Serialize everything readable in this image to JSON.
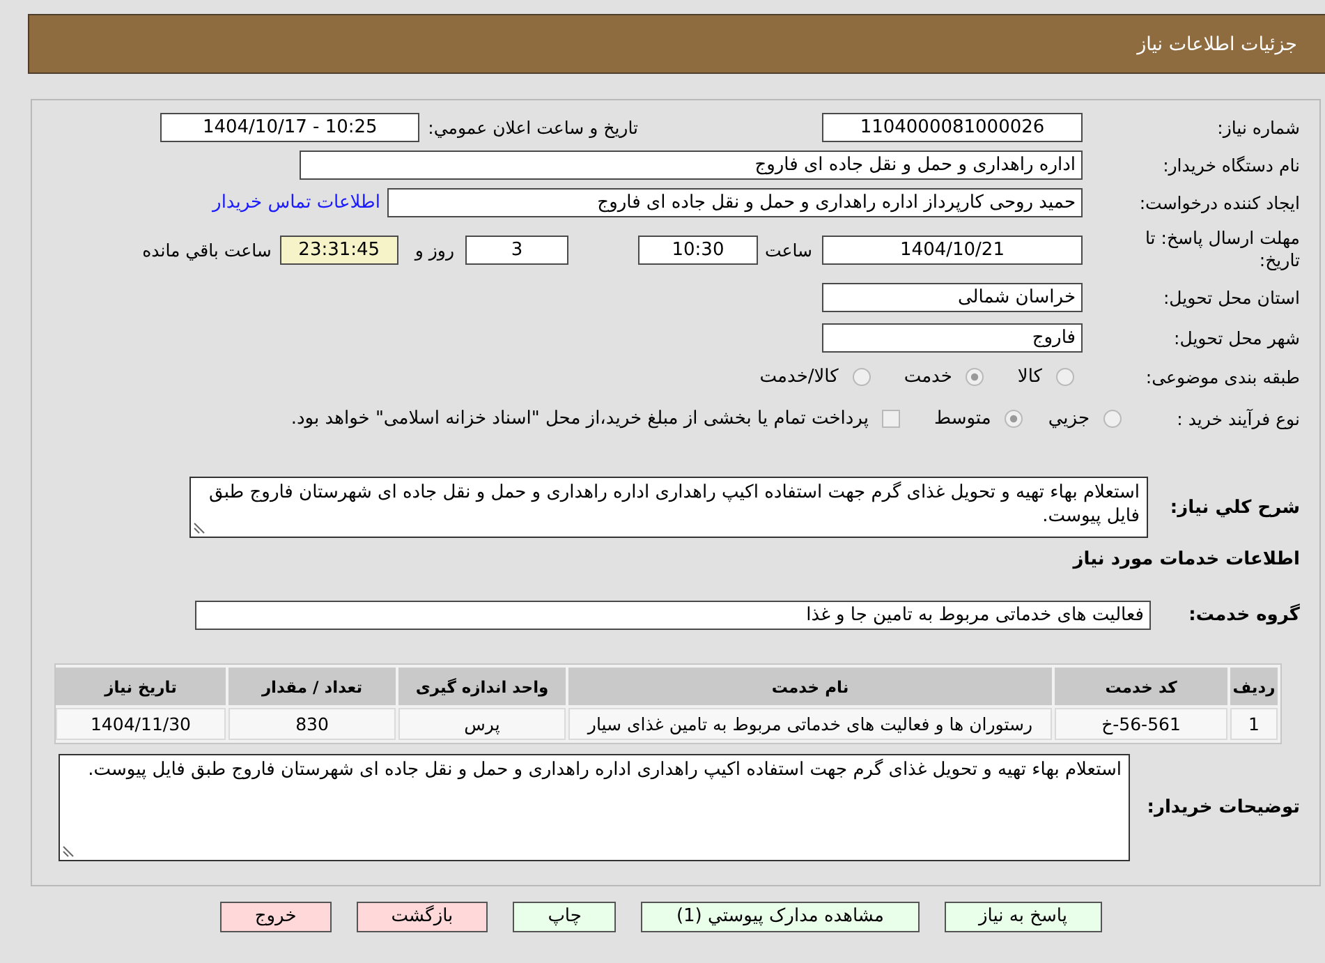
{
  "header": {
    "title": "جزئيات اطلاعات نياز"
  },
  "need_details": {
    "need_number": {
      "label": "شماره نیاز:",
      "value": "1104000081000026"
    },
    "announcement": {
      "label": "تاریخ و ساعت اعلان عمومي:",
      "value": "1404/10/17 - 10:25"
    },
    "buyer_organization": {
      "label": "نام دستگاه خریدار:",
      "value": "اداره راهداری و حمل و نقل جاده ای فاروج"
    },
    "requester": {
      "label": "ایجاد کننده درخواست:",
      "value": "حمید روحی کارپرداز اداره راهداری و حمل و نقل جاده ای فاروج",
      "contact_link": "اطلاعات تماس خریدار"
    },
    "deadline": {
      "label": "مهلت ارسال پاسخ: تا تاریخ:",
      "date": "1404/10/21",
      "time_label": "ساعت",
      "time": "10:30",
      "days": "3",
      "days_label": "روز و",
      "remaining": "23:31:45",
      "remaining_label": "ساعت باقي مانده"
    },
    "province": {
      "label": "استان محل تحویل:",
      "value": "خراسان شمالی"
    },
    "city": {
      "label": "شهر محل تحویل:",
      "value": "فاروج"
    },
    "category": {
      "label": "طبقه بندی موضوعی:",
      "options": [
        {
          "label": "کالا",
          "selected": false,
          "disabled": true
        },
        {
          "label": "خدمت",
          "selected": true,
          "disabled": true
        },
        {
          "label": "کالا/خدمت",
          "selected": false,
          "disabled": true
        }
      ]
    },
    "purchase_type": {
      "label": "نوع فرآیند خرید :",
      "options": [
        {
          "label": "جزيي",
          "selected": false,
          "disabled": true
        },
        {
          "label": "متوسط",
          "selected": true,
          "disabled": true
        }
      ],
      "treasury_payment": {
        "label": "پرداخت تمام یا بخشی از مبلغ خرید،از محل \"اسناد خزانه اسلامی\" خواهد بود.",
        "checked": false,
        "disabled": true
      }
    },
    "description": {
      "label": "شرح کلي نیاز:",
      "value": "استعلام بهاء تهیه و تحویل غذای گرم جهت استفاده اکیپ راهداری اداره راهداری و حمل و نقل جاده ای شهرستان فاروج طبق فایل پیوست."
    }
  },
  "services": {
    "title": "اطلاعات خدمات مورد نیاز",
    "group": {
      "label": "گروه خدمت:",
      "value": "فعالیت های خدماتی مربوط به تامین جا و غذا"
    },
    "table": {
      "columns": [
        "ردیف",
        "کد خدمت",
        "نام خدمت",
        "واحد اندازه گیری",
        "تعداد / مقدار",
        "تاریخ نیاز"
      ],
      "rows": [
        [
          "1",
          "56-561-خ",
          "رستوران ها و فعالیت های خدماتی مربوط به تامین غذای سیار",
          "پرس",
          "830",
          "1404/11/30"
        ]
      ]
    }
  },
  "buyer_notes": {
    "label": "توضیحات خریدار:",
    "value": "استعلام بهاء تهیه و تحویل غذای گرم جهت استفاده اکیپ راهداری اداره راهداری و حمل و نقل جاده ای شهرستان فاروج طبق فایل پیوست."
  },
  "buttons": [
    {
      "label": "پاسخ به نیاز",
      "color": "#eaffea"
    },
    {
      "label": "مشاهده مدارک پیوستي (1)",
      "color": "#eaffea"
    },
    {
      "label": "چاپ",
      "color": "#eaffea"
    },
    {
      "label": "بازگشت",
      "color": "#ffd9d9"
    },
    {
      "label": "خروج",
      "color": "#ffd9d9"
    }
  ]
}
